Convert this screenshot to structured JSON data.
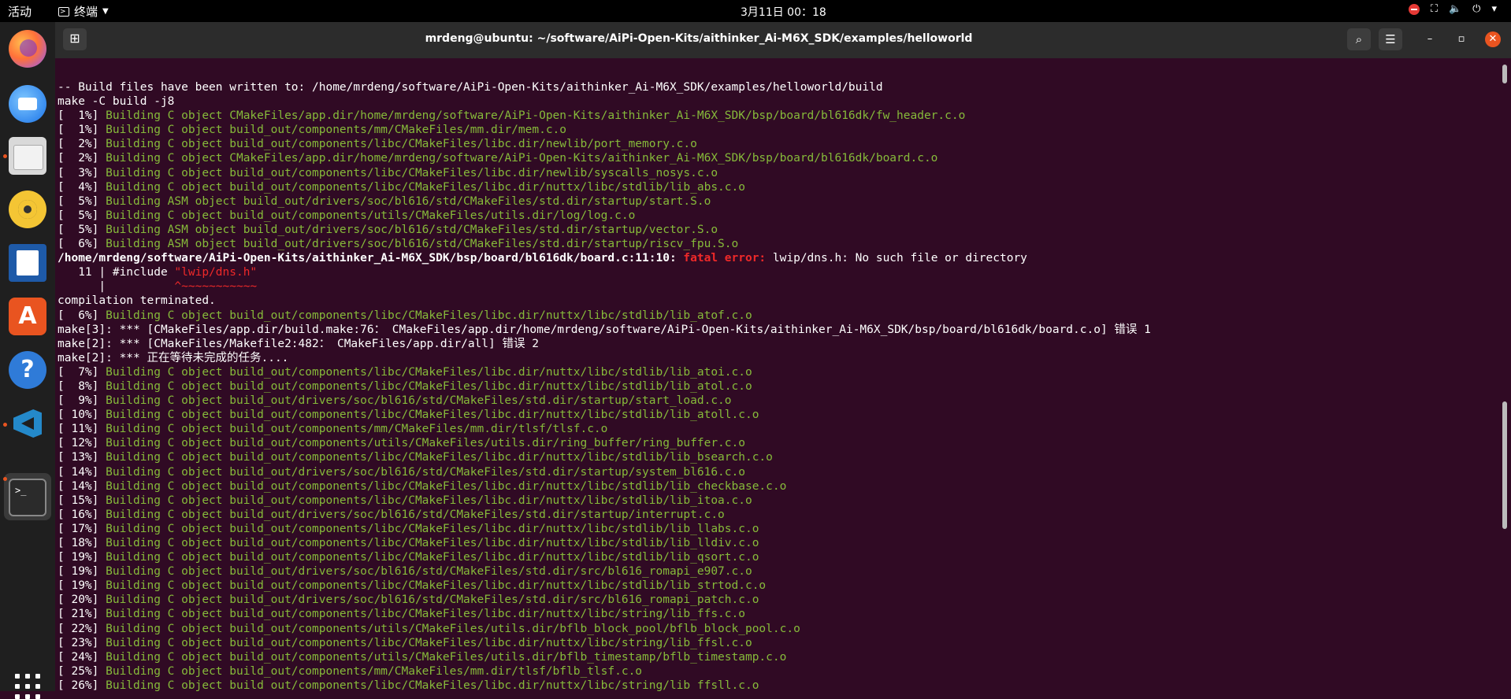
{
  "topbar": {
    "activities": "活动",
    "app_name": "终端",
    "clock": "3月11日  00：18"
  },
  "dock": {
    "items": [
      "firefox-icon",
      "thunderbird-icon",
      "files-icon",
      "rhythmbox-icon",
      "libreoffice-writer-icon",
      "app-store-icon",
      "help-icon",
      "vscode-icon",
      "terminal-icon"
    ],
    "terminal_glyph": ">_"
  },
  "window": {
    "title": "mrdeng@ubuntu: ~/software/AiPi-Open-Kits/aithinker_Ai-M6X_SDK/examples/helloworld"
  },
  "colors": {
    "terminal_bg": "#300a24",
    "green": "#86ba3a",
    "error_red": "#ef2929",
    "accent": "#e95420"
  },
  "terminal": {
    "l0": "-- Build files have been written to: /home/mrdeng/software/AiPi-Open-Kits/aithinker_Ai-M6X_SDK/examples/helloworld/build",
    "l1": "make -C build -j8",
    "p2": "[  1%] ",
    "t2": "Building C object CMakeFiles/app.dir/home/mrdeng/software/AiPi-Open-Kits/aithinker_Ai-M6X_SDK/bsp/board/bl616dk/fw_header.c.o",
    "p3": "[  1%] ",
    "t3": "Building C object build_out/components/mm/CMakeFiles/mm.dir/mem.c.o",
    "p4": "[  2%] ",
    "t4": "Building C object build_out/components/libc/CMakeFiles/libc.dir/newlib/port_memory.c.o",
    "p5": "[  2%] ",
    "t5": "Building C object CMakeFiles/app.dir/home/mrdeng/software/AiPi-Open-Kits/aithinker_Ai-M6X_SDK/bsp/board/bl616dk/board.c.o",
    "p6": "[  3%] ",
    "t6": "Building C object build_out/components/libc/CMakeFiles/libc.dir/newlib/syscalls_nosys.c.o",
    "p7": "[  4%] ",
    "t7": "Building C object build_out/components/libc/CMakeFiles/libc.dir/nuttx/libc/stdlib/lib_abs.c.o",
    "p8": "[  5%] ",
    "t8": "Building ASM object build_out/drivers/soc/bl616/std/CMakeFiles/std.dir/startup/start.S.o",
    "p9": "[  5%] ",
    "t9": "Building C object build_out/components/utils/CMakeFiles/utils.dir/log/log.c.o",
    "p10": "[  5%] ",
    "t10": "Building ASM object build_out/drivers/soc/bl616/std/CMakeFiles/std.dir/startup/vector.S.o",
    "p11": "[  6%] ",
    "t11": "Building ASM object build_out/drivers/soc/bl616/std/CMakeFiles/std.dir/startup/riscv_fpu.S.o",
    "e12a": "/home/mrdeng/software/AiPi-Open-Kits/aithinker_Ai-M6X_SDK/bsp/board/bl616dk/board.c:11:10: ",
    "e12b": "fatal error: ",
    "e12c": "lwip/dns.h: No such file or directory",
    "l13a": "   11 | #include ",
    "l13b": "\"lwip/dns.h\"",
    "l14a": "      |          ",
    "l14b": "^~~~~~~~~~~~",
    "l15": "compilation terminated.",
    "p16": "[  6%] ",
    "t16": "Building C object build_out/components/libc/CMakeFiles/libc.dir/nuttx/libc/stdlib/lib_atof.c.o",
    "l17": "make[3]: *** [CMakeFiles/app.dir/build.make:76： CMakeFiles/app.dir/home/mrdeng/software/AiPi-Open-Kits/aithinker_Ai-M6X_SDK/bsp/board/bl616dk/board.c.o] 错误 1",
    "l18": "make[2]: *** [CMakeFiles/Makefile2:482： CMakeFiles/app.dir/all] 错误 2",
    "l19": "make[2]: *** 正在等待未完成的任务....",
    "p20": "[  7%] ",
    "t20": "Building C object build_out/components/libc/CMakeFiles/libc.dir/nuttx/libc/stdlib/lib_atoi.c.o",
    "p21": "[  8%] ",
    "t21": "Building C object build_out/components/libc/CMakeFiles/libc.dir/nuttx/libc/stdlib/lib_atol.c.o",
    "p22": "[  9%] ",
    "t22": "Building C object build_out/drivers/soc/bl616/std/CMakeFiles/std.dir/startup/start_load.c.o",
    "p23": "[ 10%] ",
    "t23": "Building C object build_out/components/libc/CMakeFiles/libc.dir/nuttx/libc/stdlib/lib_atoll.c.o",
    "p24": "[ 11%] ",
    "t24": "Building C object build_out/components/mm/CMakeFiles/mm.dir/tlsf/tlsf.c.o",
    "p25": "[ 12%] ",
    "t25": "Building C object build_out/components/utils/CMakeFiles/utils.dir/ring_buffer/ring_buffer.c.o",
    "p26": "[ 13%] ",
    "t26": "Building C object build_out/components/libc/CMakeFiles/libc.dir/nuttx/libc/stdlib/lib_bsearch.c.o",
    "p27": "[ 14%] ",
    "t27": "Building C object build_out/drivers/soc/bl616/std/CMakeFiles/std.dir/startup/system_bl616.c.o",
    "p28": "[ 14%] ",
    "t28": "Building C object build_out/components/libc/CMakeFiles/libc.dir/nuttx/libc/stdlib/lib_checkbase.c.o",
    "p29": "[ 15%] ",
    "t29": "Building C object build_out/components/libc/CMakeFiles/libc.dir/nuttx/libc/stdlib/lib_itoa.c.o",
    "p30": "[ 16%] ",
    "t30": "Building C object build_out/drivers/soc/bl616/std/CMakeFiles/std.dir/startup/interrupt.c.o",
    "p31": "[ 17%] ",
    "t31": "Building C object build_out/components/libc/CMakeFiles/libc.dir/nuttx/libc/stdlib/lib_llabs.c.o",
    "p32": "[ 18%] ",
    "t32": "Building C object build_out/components/libc/CMakeFiles/libc.dir/nuttx/libc/stdlib/lib_lldiv.c.o",
    "p33": "[ 19%] ",
    "t33": "Building C object build_out/components/libc/CMakeFiles/libc.dir/nuttx/libc/stdlib/lib_qsort.c.o",
    "p34": "[ 19%] ",
    "t34": "Building C object build_out/drivers/soc/bl616/std/CMakeFiles/std.dir/src/bl616_romapi_e907.c.o",
    "p35": "[ 19%] ",
    "t35": "Building C object build_out/components/libc/CMakeFiles/libc.dir/nuttx/libc/stdlib/lib_strtod.c.o",
    "p36": "[ 20%] ",
    "t36": "Building C object build_out/drivers/soc/bl616/std/CMakeFiles/std.dir/src/bl616_romapi_patch.c.o",
    "p37": "[ 21%] ",
    "t37": "Building C object build_out/components/libc/CMakeFiles/libc.dir/nuttx/libc/string/lib_ffs.c.o",
    "p38": "[ 22%] ",
    "t38": "Building C object build_out/components/utils/CMakeFiles/utils.dir/bflb_block_pool/bflb_block_pool.c.o",
    "p39": "[ 23%] ",
    "t39": "Building C object build_out/components/libc/CMakeFiles/libc.dir/nuttx/libc/string/lib_ffsl.c.o",
    "p40": "[ 24%] ",
    "t40": "Building C object build_out/components/utils/CMakeFiles/utils.dir/bflb_timestamp/bflb_timestamp.c.o",
    "p41": "[ 25%] ",
    "t41": "Building C object build_out/components/mm/CMakeFiles/mm.dir/tlsf/bflb_tlsf.c.o",
    "p42": "[ 26%] ",
    "t42": "Building C object build_out/components/libc/CMakeFiles/libc.dir/nuttx/libc/string/lib_ffsll.c.o"
  }
}
